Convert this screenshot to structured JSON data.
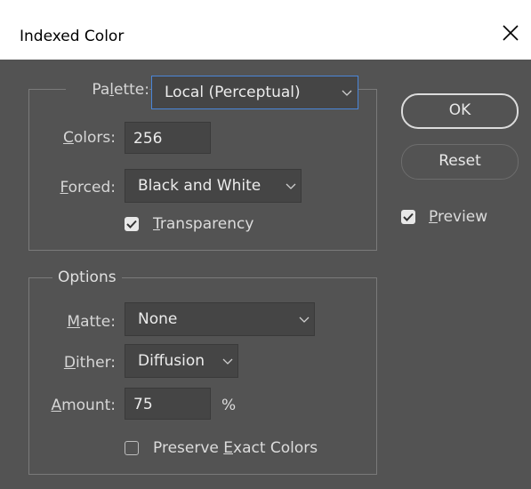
{
  "window": {
    "title": "Indexed Color",
    "close_icon": "close-icon"
  },
  "palette_group": {
    "palette_label": "Palette:",
    "palette_value": "Local (Perceptual)",
    "colors_label": "Colors:",
    "colors_value": "256",
    "forced_label": "Forced:",
    "forced_value": "Black and White",
    "transparency_label": "Transparency",
    "transparency_checked": true
  },
  "options_group": {
    "legend": "Options",
    "matte_label": "Matte:",
    "matte_value": "None",
    "dither_label": "Dither:",
    "dither_value": "Diffusion",
    "amount_label": "Amount:",
    "amount_value": "75",
    "amount_unit": "%",
    "preserve_label": "Preserve Exact Colors",
    "preserve_checked": false
  },
  "buttons": {
    "ok_label": "OK",
    "reset_label": "Reset"
  },
  "preview": {
    "label": "Preview",
    "checked": true
  },
  "colors": {
    "background": "#535353",
    "titlebar": "#ffffff",
    "field": "#454545",
    "focus_border": "#4a86d8",
    "text": "#dcdcdc"
  }
}
